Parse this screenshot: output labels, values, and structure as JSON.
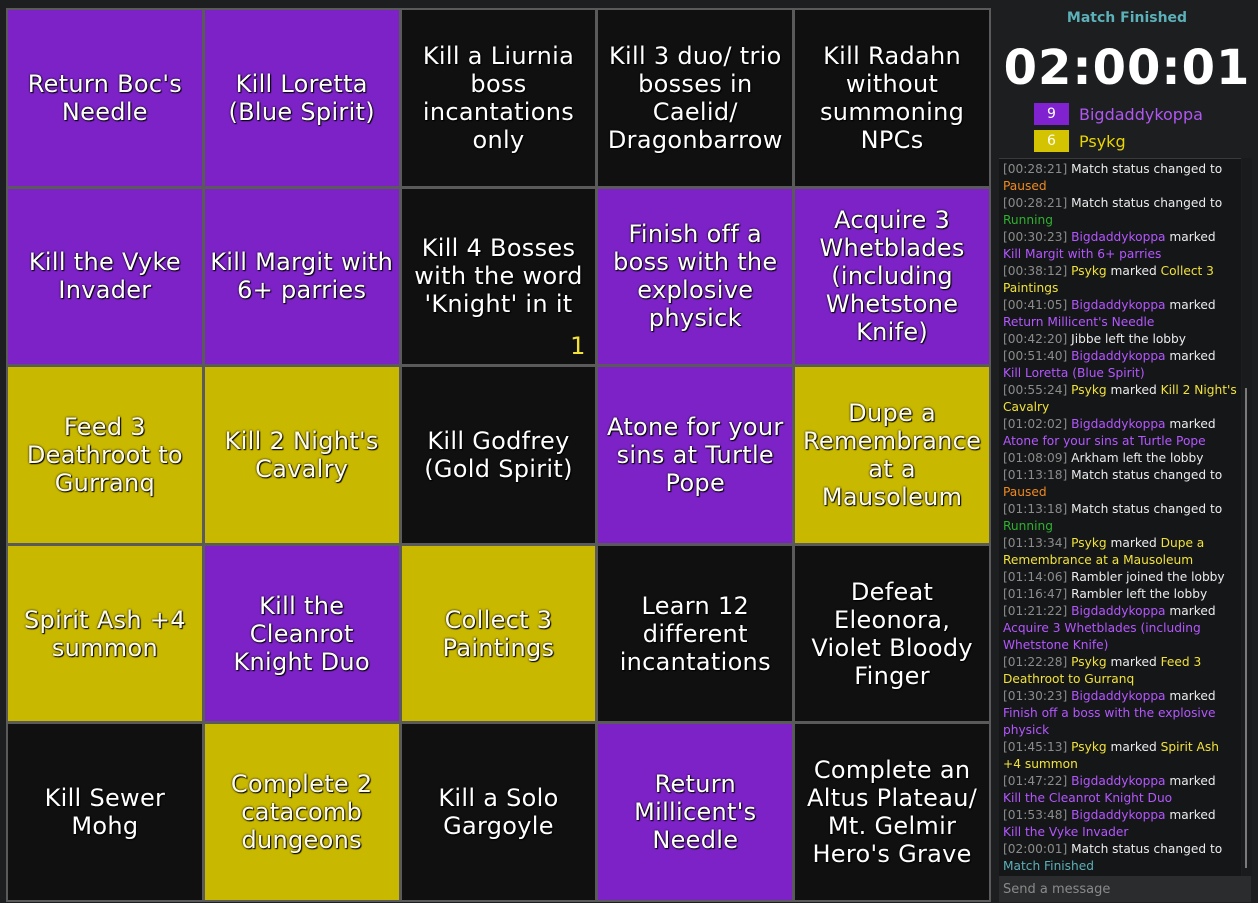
{
  "board": {
    "colors": {
      "black": "#101010",
      "purple": "#7c22c7",
      "yellow": "#c9b800"
    },
    "cells": [
      {
        "text": "Return Boc's Needle",
        "color": "purple"
      },
      {
        "text": "Kill Loretta (Blue Spirit)",
        "color": "purple"
      },
      {
        "text": "Kill a Liurnia boss incantations only",
        "color": "black"
      },
      {
        "text": "Kill 3 duo/ trio bosses in Caelid/ Dragonbarrow",
        "color": "black"
      },
      {
        "text": "Kill Radahn without summoning NPCs",
        "color": "black"
      },
      {
        "text": "Kill the Vyke Invader",
        "color": "purple"
      },
      {
        "text": "Kill Margit with 6+ parries",
        "color": "purple"
      },
      {
        "text": "Kill 4 Bosses with the word 'Knight' in it",
        "color": "black",
        "count": "1"
      },
      {
        "text": "Finish off a boss with the explosive physick",
        "color": "purple"
      },
      {
        "text": "Acquire 3 Whetblades (including Whetstone Knife)",
        "color": "purple"
      },
      {
        "text": "Feed 3 Deathroot to Gurranq",
        "color": "yellow"
      },
      {
        "text": "Kill 2 Night's Cavalry",
        "color": "yellow"
      },
      {
        "text": "Kill Godfrey (Gold Spirit)",
        "color": "black"
      },
      {
        "text": "Atone for your sins at Turtle Pope",
        "color": "purple"
      },
      {
        "text": "Dupe a Remembrance at a Mausoleum",
        "color": "yellow"
      },
      {
        "text": "Spirit Ash +4 summon",
        "color": "yellow"
      },
      {
        "text": "Kill the Cleanrot Knight Duo",
        "color": "purple"
      },
      {
        "text": "Collect 3 Paintings",
        "color": "yellow"
      },
      {
        "text": "Learn 12 different incantations",
        "color": "black"
      },
      {
        "text": "Defeat Eleonora, Violet Bloody Finger",
        "color": "black"
      },
      {
        "text": "Kill Sewer Mohg",
        "color": "black"
      },
      {
        "text": "Complete 2 catacomb dungeons",
        "color": "yellow"
      },
      {
        "text": "Kill a Solo Gargoyle",
        "color": "black"
      },
      {
        "text": "Return Millicent's Needle",
        "color": "purple"
      },
      {
        "text": "Complete an Altus Plateau/ Mt. Gelmir Hero's Grave",
        "color": "black"
      }
    ]
  },
  "sidebar": {
    "status": "Match Finished",
    "timer": "02:00:01",
    "players": [
      {
        "score": "9",
        "name": "Bigdaddykoppa",
        "color": "#8122d0"
      },
      {
        "score": "6",
        "name": "Psykg",
        "color": "#d4c300"
      }
    ]
  },
  "chat": {
    "messages": [
      [
        {
          "t": "[00:28:21] ",
          "c": "ts"
        },
        {
          "t": "Match status changed to ",
          "c": ""
        },
        {
          "t": "Paused",
          "c": "orange-t"
        }
      ],
      [
        {
          "t": "[00:28:21] ",
          "c": "ts"
        },
        {
          "t": "Match status changed to ",
          "c": ""
        },
        {
          "t": "Running",
          "c": "green-t"
        }
      ],
      [
        {
          "t": "[00:30:23] ",
          "c": "ts"
        },
        {
          "t": "Bigdaddykoppa",
          "c": "purple-t"
        },
        {
          "t": " marked ",
          "c": ""
        },
        {
          "t": "Kill Margit with 6+ parries",
          "c": "purple-t"
        }
      ],
      [
        {
          "t": "[00:38:12] ",
          "c": "ts"
        },
        {
          "t": "Psykg",
          "c": "yellow-t"
        },
        {
          "t": " marked ",
          "c": ""
        },
        {
          "t": "Collect 3 Paintings",
          "c": "yellow-t"
        }
      ],
      [
        {
          "t": "[00:41:05] ",
          "c": "ts"
        },
        {
          "t": "Bigdaddykoppa",
          "c": "purple-t"
        },
        {
          "t": " marked ",
          "c": ""
        },
        {
          "t": "Return Millicent's Needle",
          "c": "purple-t"
        }
      ],
      [
        {
          "t": "[00:42:20] ",
          "c": "ts"
        },
        {
          "t": "Jibbe left the lobby",
          "c": ""
        }
      ],
      [
        {
          "t": "[00:51:40] ",
          "c": "ts"
        },
        {
          "t": "Bigdaddykoppa",
          "c": "purple-t"
        },
        {
          "t": " marked ",
          "c": ""
        },
        {
          "t": "Kill Loretta (Blue Spirit)",
          "c": "purple-t"
        }
      ],
      [
        {
          "t": "[00:55:24] ",
          "c": "ts"
        },
        {
          "t": "Psykg",
          "c": "yellow-t"
        },
        {
          "t": " marked ",
          "c": ""
        },
        {
          "t": "Kill 2 Night's Cavalry",
          "c": "yellow-t"
        }
      ],
      [
        {
          "t": "[01:02:02] ",
          "c": "ts"
        },
        {
          "t": "Bigdaddykoppa",
          "c": "purple-t"
        },
        {
          "t": " marked ",
          "c": ""
        },
        {
          "t": "Atone for your sins at Turtle Pope",
          "c": "purple-t"
        }
      ],
      [
        {
          "t": "[01:08:09] ",
          "c": "ts"
        },
        {
          "t": "Arkham left the lobby",
          "c": ""
        }
      ],
      [
        {
          "t": "[01:13:18] ",
          "c": "ts"
        },
        {
          "t": "Match status changed to ",
          "c": ""
        },
        {
          "t": "Paused",
          "c": "orange-t"
        }
      ],
      [
        {
          "t": "[01:13:18] ",
          "c": "ts"
        },
        {
          "t": "Match status changed to ",
          "c": ""
        },
        {
          "t": "Running",
          "c": "green-t"
        }
      ],
      [
        {
          "t": "[01:13:34] ",
          "c": "ts"
        },
        {
          "t": "Psykg",
          "c": "yellow-t"
        },
        {
          "t": " marked ",
          "c": ""
        },
        {
          "t": "Dupe a Remembrance at a Mausoleum",
          "c": "yellow-t"
        }
      ],
      [
        {
          "t": "[01:14:06] ",
          "c": "ts"
        },
        {
          "t": "Rambler joined the lobby",
          "c": ""
        }
      ],
      [
        {
          "t": "[01:16:47] ",
          "c": "ts"
        },
        {
          "t": "Rambler left the lobby",
          "c": ""
        }
      ],
      [
        {
          "t": "[01:21:22] ",
          "c": "ts"
        },
        {
          "t": "Bigdaddykoppa",
          "c": "purple-t"
        },
        {
          "t": " marked ",
          "c": ""
        },
        {
          "t": "Acquire 3 Whetblades (including Whetstone Knife)",
          "c": "purple-t"
        }
      ],
      [
        {
          "t": "[01:22:28] ",
          "c": "ts"
        },
        {
          "t": "Psykg",
          "c": "yellow-t"
        },
        {
          "t": " marked ",
          "c": ""
        },
        {
          "t": "Feed 3 Deathroot to Gurranq",
          "c": "yellow-t"
        }
      ],
      [
        {
          "t": "[01:30:23] ",
          "c": "ts"
        },
        {
          "t": "Bigdaddykoppa",
          "c": "purple-t"
        },
        {
          "t": " marked ",
          "c": ""
        },
        {
          "t": "Finish off a boss with the explosive physick",
          "c": "purple-t"
        }
      ],
      [
        {
          "t": "[01:45:13] ",
          "c": "ts"
        },
        {
          "t": "Psykg",
          "c": "yellow-t"
        },
        {
          "t": " marked ",
          "c": ""
        },
        {
          "t": "Spirit Ash +4 summon",
          "c": "yellow-t"
        }
      ],
      [
        {
          "t": "[01:47:22] ",
          "c": "ts"
        },
        {
          "t": "Bigdaddykoppa",
          "c": "purple-t"
        },
        {
          "t": " marked ",
          "c": ""
        },
        {
          "t": "Kill the Cleanrot Knight Duo",
          "c": "purple-t"
        }
      ],
      [
        {
          "t": "[01:53:48] ",
          "c": "ts"
        },
        {
          "t": "Bigdaddykoppa",
          "c": "purple-t"
        },
        {
          "t": " marked ",
          "c": ""
        },
        {
          "t": "Kill the Vyke Invader",
          "c": "purple-t"
        }
      ],
      [
        {
          "t": "[02:00:01] ",
          "c": "ts"
        },
        {
          "t": "Match status changed to ",
          "c": ""
        },
        {
          "t": "Match Finished",
          "c": "teal-t"
        }
      ]
    ],
    "input_placeholder": "Send a message"
  }
}
